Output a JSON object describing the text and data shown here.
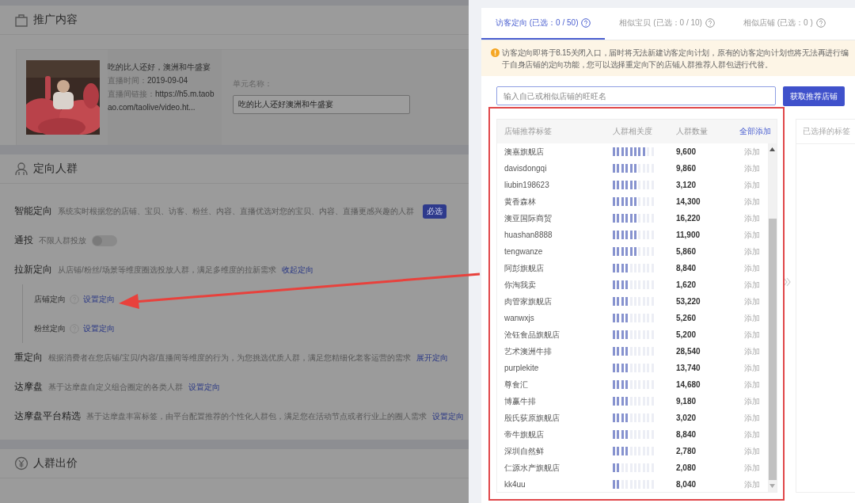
{
  "content_section": {
    "title": "推广内容",
    "live": {
      "title": "吃的比人还好，澳洲和牛盛宴",
      "time_label": "直播时间：",
      "time": "2019-09-04",
      "link_label": "直播间链接：",
      "link": "https://h5.m.taobao.com/taolive/video.ht..."
    },
    "unit_name": {
      "label": "单元名称：",
      "value": "吃的比人还好澳洲和牛盛宴"
    }
  },
  "audience_section": {
    "title": "定向人群",
    "items": [
      {
        "title": "智能定向",
        "description": "系统实时根据您的店铺、宝贝、访客、粉丝、内容、直播优选对您的宝贝、内容、直播更感兴趣的人群",
        "badge": "必选"
      },
      {
        "title": "通投",
        "description": "不限人群投放",
        "toggle": {
          "on": false
        }
      },
      {
        "title": "拉新定向",
        "description": "从店铺/粉丝/场景等维度圈选投放人群，满足多维度的拉新需求",
        "link": "收起定向",
        "children": [
          {
            "title": "店铺定向",
            "link": "设置定向"
          },
          {
            "title": "粉丝定向",
            "link": "设置定向"
          }
        ]
      },
      {
        "title": "重定向",
        "description": "根据消费者在您店铺/宝贝/内容/直播间等维度的行为，为您挑选优质人群，满足您精细化老客运营的需求",
        "link": "展开定向"
      },
      {
        "title": "达摩盘",
        "description": "基于达摩盘自定义组合圈定的各类人群",
        "link": "设置定向"
      },
      {
        "title": "达摩盘平台精选",
        "description": "基于达摩盘丰富标签，由平台配置推荐的个性化人群包，满足您在活动节点或者行业上的圈人需求",
        "link": "设置定向"
      }
    ]
  },
  "bid_section": {
    "title": "人群出价"
  },
  "drawer": {
    "tabs": [
      {
        "label": "访客定向 (已选：0 / 50)",
        "selected": true
      },
      {
        "label": "相似宝贝 (已选：0 / 10)",
        "selected": false
      },
      {
        "label": "相似店铺 (已选：0 )",
        "selected": false
      }
    ],
    "notice": [
      "访客定向即将于8.15关闭入口，届时将无法新建访客定向计划，原有的访客定向计划也将无法再进行编",
      "于自身店铺的定向功能，您可以选择重定向下的店铺人群推荐人群包进行代替。"
    ],
    "search": {
      "placeholder": "输入自己或相似店铺的旺旺名"
    },
    "fetch_button": "获取推荐店铺",
    "table": {
      "columns": [
        "店铺推荐标签",
        "人群相关度",
        "人群数量"
      ],
      "add_all": "全部添加",
      "rows": [
        {
          "name": "澳嘉旗舰店",
          "level": 0.8,
          "count": "9,600",
          "action": "添加"
        },
        {
          "name": "davisdongqi",
          "level": 0.6,
          "count": "9,860",
          "action": "添加"
        },
        {
          "name": "liubin198623",
          "level": 0.6,
          "count": "3,120",
          "action": "添加"
        },
        {
          "name": "黄香森林",
          "level": 0.6,
          "count": "14,300",
          "action": "添加"
        },
        {
          "name": "澳亚国际商贸",
          "level": 0.6,
          "count": "16,220",
          "action": "添加"
        },
        {
          "name": "huashan8888",
          "level": 0.6,
          "count": "11,900",
          "action": "添加"
        },
        {
          "name": "tengwanze",
          "level": 0.6,
          "count": "5,860",
          "action": "添加"
        },
        {
          "name": "阿彭旗舰店",
          "level": 0.4,
          "count": "8,840",
          "action": "添加"
        },
        {
          "name": "你淘我卖",
          "level": 0.4,
          "count": "1,620",
          "action": "添加"
        },
        {
          "name": "肉管家旗舰店",
          "level": 0.4,
          "count": "53,220",
          "action": "添加"
        },
        {
          "name": "wanwxjs",
          "level": 0.4,
          "count": "5,260",
          "action": "添加"
        },
        {
          "name": "沧钰食品旗舰店",
          "level": 0.4,
          "count": "5,200",
          "action": "添加"
        },
        {
          "name": "艺术澳洲牛排",
          "level": 0.4,
          "count": "28,540",
          "action": "添加"
        },
        {
          "name": "purplekite",
          "level": 0.4,
          "count": "13,740",
          "action": "添加"
        },
        {
          "name": "尊食汇",
          "level": 0.4,
          "count": "14,680",
          "action": "添加"
        },
        {
          "name": "博赢牛排",
          "level": 0.4,
          "count": "9,180",
          "action": "添加"
        },
        {
          "name": "殷氏荻原旗舰店",
          "level": 0.4,
          "count": "3,020",
          "action": "添加"
        },
        {
          "name": "帝牛旗舰店",
          "level": 0.4,
          "count": "8,840",
          "action": "添加"
        },
        {
          "name": "深圳自然鲜",
          "level": 0.4,
          "count": "2,780",
          "action": "添加"
        },
        {
          "name": "仁源水产旗舰店",
          "level": 0.2,
          "count": "2,080",
          "action": "添加"
        },
        {
          "name": "kk4uu",
          "level": 0.2,
          "count": "8,040",
          "action": "添加"
        }
      ]
    },
    "selected_panel": {
      "title": "已选择的标签"
    }
  }
}
